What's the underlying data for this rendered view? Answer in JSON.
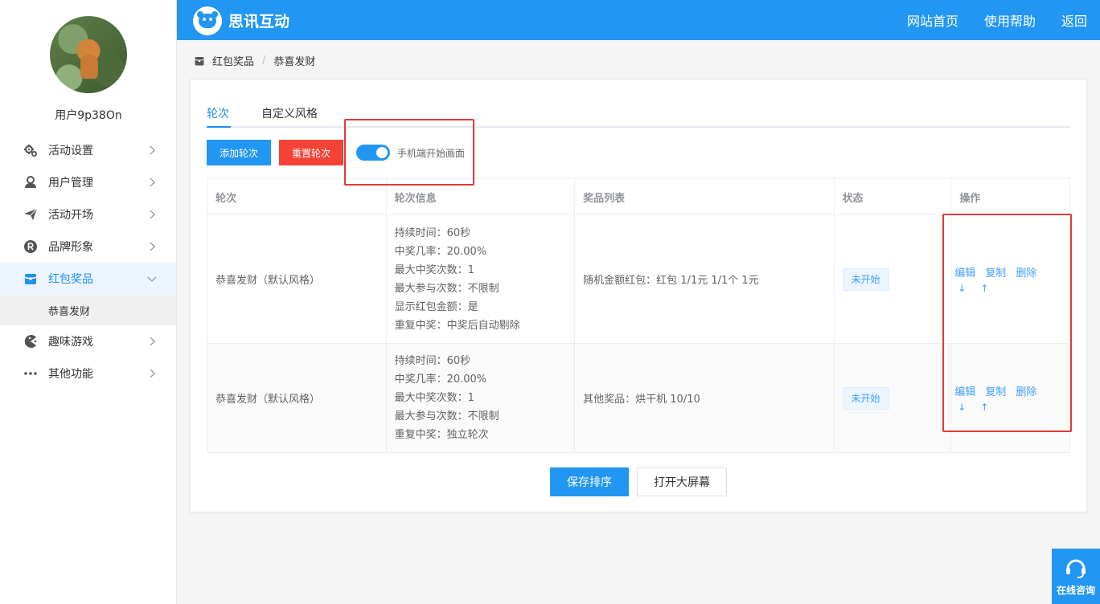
{
  "app": {
    "brand": "思讯互动",
    "top_nav": [
      "网站首页",
      "使用帮助",
      "返回"
    ]
  },
  "user": {
    "name": "用户9p38On"
  },
  "sidebar": {
    "items": [
      {
        "label": "活动设置",
        "icon": "gears-icon"
      },
      {
        "label": "用户管理",
        "icon": "user-icon"
      },
      {
        "label": "活动开场",
        "icon": "paper-plane-icon"
      },
      {
        "label": "品牌形象",
        "icon": "registered-icon"
      },
      {
        "label": "红包奖品",
        "icon": "gift-box-icon",
        "active": true
      },
      {
        "label": "趣味游戏",
        "icon": "pacman-icon"
      },
      {
        "label": "其他功能",
        "icon": "more-dots-icon"
      }
    ],
    "sub_item": "恭喜发财"
  },
  "breadcrumb": {
    "parent": "红包奖品",
    "separator": "/",
    "current": "恭喜发财"
  },
  "tabs": [
    "轮次",
    "自定义风格"
  ],
  "toolbar": {
    "add_round": "添加轮次",
    "reset_round": "重置轮次",
    "switch_label": "手机端开始画面",
    "switch_on": true
  },
  "table": {
    "headers": [
      "轮次",
      "轮次信息",
      "奖品列表",
      "状态",
      "操作"
    ],
    "rows": [
      {
        "round": "恭喜发财（默认风格）",
        "info": [
          "持续时间：60秒",
          "中奖几率：20.00%",
          "最大中奖次数：1",
          "最大参与次数：不限制",
          "显示红包金额：是",
          "重复中奖：中奖后自动剔除"
        ],
        "prizes": "随机金额红包：红包 1/1元 1/1个 1元",
        "status": "未开始"
      },
      {
        "round": "恭喜发财（默认风格）",
        "info": [
          "持续时间：60秒",
          "中奖几率：20.00%",
          "最大中奖次数：1",
          "最大参与次数：不限制",
          "重复中奖：独立轮次"
        ],
        "prizes": "其他奖品：烘干机 10/10",
        "status": "未开始"
      }
    ],
    "ops": {
      "edit": "编辑",
      "copy": "复制",
      "delete": "删除",
      "down": "↓",
      "up": "↑"
    }
  },
  "footer_buttons": {
    "save": "保存排序",
    "screen": "打开大屏幕"
  },
  "consult": {
    "label": "在线咨询"
  },
  "colors": {
    "primary": "#2196f3",
    "danger": "#f44336",
    "highlight": "#e53935"
  }
}
